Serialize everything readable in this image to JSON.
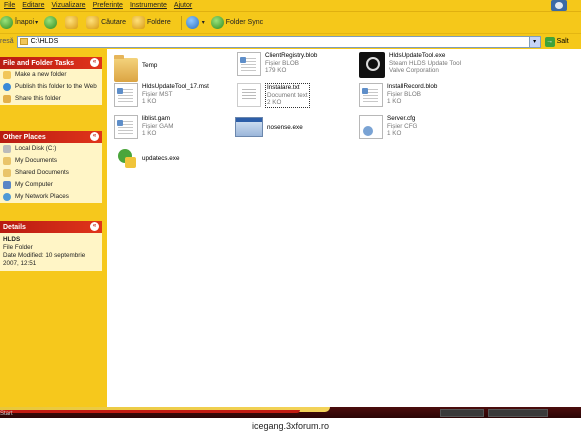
{
  "menu": [
    "File",
    "Editare",
    "Vizualizare",
    "Preferințe",
    "Instrumente",
    "Ajutor"
  ],
  "toolbar": {
    "back_label": "Înapoi",
    "search_label": "Căutare",
    "folders_label": "Foldere",
    "folder_sync_label": "Folder Sync"
  },
  "address": {
    "label": "resă",
    "path": "C:\\HLDS",
    "go_label": "Salt"
  },
  "tasks": {
    "title": "File and Folder Tasks",
    "items": [
      "Make a new folder",
      "Publish this folder to the Web",
      "Share this folder"
    ]
  },
  "places": {
    "title": "Other Places",
    "items": [
      "Local Disk (C:)",
      "My Documents",
      "Shared Documents",
      "My Computer",
      "My Network Places"
    ]
  },
  "details": {
    "title": "Details",
    "name": "HLDS",
    "type": "File Folder",
    "modified": "Date Modified: 10 septembrie 2007, 12:51"
  },
  "files": [
    {
      "name": "Temp",
      "type": "",
      "size": ""
    },
    {
      "name": "ClientRegistry.blob",
      "type": "Fișier BLOB",
      "size": "179 KO"
    },
    {
      "name": "HldsUpdateTool.exe",
      "type": "Steam HLDS Update Tool",
      "size": "Valve Corporation"
    },
    {
      "name": "HldsUpdateTool_17.mst",
      "type": "Fișier MST",
      "size": "1 KO"
    },
    {
      "name": "Instalare.txt",
      "type": "Document text",
      "size": "2 KO"
    },
    {
      "name": "InstallRecord.blob",
      "type": "Fișier BLOB",
      "size": "1 KO"
    },
    {
      "name": "liblist.gam",
      "type": "Fișier GAM",
      "size": "1 KO"
    },
    {
      "name": "nosense.exe",
      "type": "",
      "size": ""
    },
    {
      "name": "Server.cfg",
      "type": "Fișier CFG",
      "size": "1 KO"
    },
    {
      "name": "updatecs.exe",
      "type": "",
      "size": ""
    }
  ],
  "taskbar": {
    "start_label": "Start"
  },
  "footer": {
    "text": "icegang.3xforum.ro"
  }
}
